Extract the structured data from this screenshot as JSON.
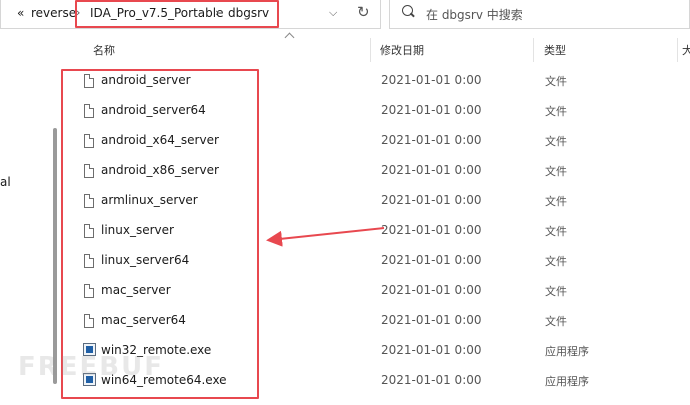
{
  "address_bar": {
    "overflow": "«",
    "crumbs": [
      "reverse",
      "IDA_Pro_v7.5_Portable",
      "dbgsrv"
    ]
  },
  "search": {
    "placeholder": "在 dbgsrv 中搜索"
  },
  "left_pane": {
    "text": "al"
  },
  "columns": {
    "name": "名称",
    "modified": "修改日期",
    "type": "类型",
    "size": "大"
  },
  "files": [
    {
      "name": "android_server",
      "date": "2021-01-01 0:00",
      "type": "文件",
      "icon": "file-icon"
    },
    {
      "name": "android_server64",
      "date": "2021-01-01 0:00",
      "type": "文件",
      "icon": "file-icon"
    },
    {
      "name": "android_x64_server",
      "date": "2021-01-01 0:00",
      "type": "文件",
      "icon": "file-icon"
    },
    {
      "name": "android_x86_server",
      "date": "2021-01-01 0:00",
      "type": "文件",
      "icon": "file-icon"
    },
    {
      "name": "armlinux_server",
      "date": "2021-01-01 0:00",
      "type": "文件",
      "icon": "file-icon"
    },
    {
      "name": "linux_server",
      "date": "2021-01-01 0:00",
      "type": "文件",
      "icon": "file-icon"
    },
    {
      "name": "linux_server64",
      "date": "2021-01-01 0:00",
      "type": "文件",
      "icon": "file-icon"
    },
    {
      "name": "mac_server",
      "date": "2021-01-01 0:00",
      "type": "文件",
      "icon": "file-icon"
    },
    {
      "name": "mac_server64",
      "date": "2021-01-01 0:00",
      "type": "文件",
      "icon": "file-icon"
    },
    {
      "name": "win32_remote.exe",
      "date": "2021-01-01 0:00",
      "type": "应用程序",
      "icon": "exe-icon"
    },
    {
      "name": "win64_remote64.exe",
      "date": "2021-01-01 0:00",
      "type": "应用程序",
      "icon": "exe-icon"
    }
  ],
  "watermark": "FREEBUF",
  "colors": {
    "annotation_red": "#e8484f",
    "exe_blue": "#1f5fa6"
  }
}
